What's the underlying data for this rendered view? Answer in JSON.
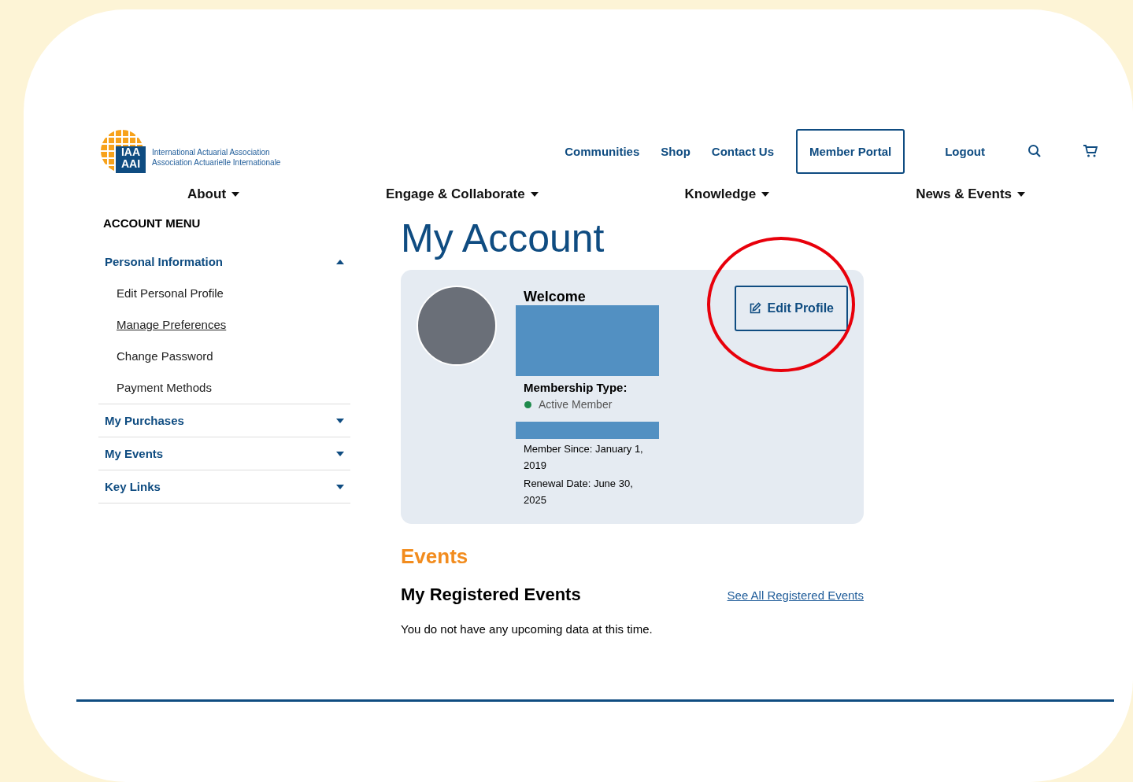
{
  "header": {
    "logo": {
      "mark_top": "IAA",
      "mark_bottom": "AAI",
      "line_1": "International Actuarial Association",
      "line_2": "Association Actuarielle Internationale"
    },
    "top_links": [
      {
        "label": "Communities",
        "kind": "link"
      },
      {
        "label": "Shop",
        "kind": "link"
      },
      {
        "label": "Contact Us",
        "kind": "link"
      },
      {
        "label": "Member Portal",
        "kind": "button"
      },
      {
        "label": "Logout",
        "kind": "link"
      }
    ]
  },
  "main_nav": [
    {
      "label": "About"
    },
    {
      "label": "Engage & Collaborate"
    },
    {
      "label": "Knowledge"
    },
    {
      "label": "News & Events"
    }
  ],
  "sidebar": {
    "title": "ACCOUNT MENU",
    "sections": [
      {
        "label": "Personal Information",
        "expanded": true,
        "children": [
          {
            "label": "Edit Personal Profile",
            "underlined": false
          },
          {
            "label": "Manage Preferences",
            "underlined": true
          },
          {
            "label": "Change Password",
            "underlined": false
          },
          {
            "label": "Payment Methods",
            "underlined": false
          }
        ]
      },
      {
        "label": "My Purchases",
        "expanded": false
      },
      {
        "label": "My Events",
        "expanded": false
      },
      {
        "label": "Key Links",
        "expanded": false
      }
    ]
  },
  "page_title": "My Account",
  "profile_card": {
    "welcome": "Welcome",
    "membership_label": "Membership Type:",
    "status": {
      "label": "Active Member",
      "color": "#1e8a4c"
    },
    "member_since": "Member Since: January 1, 2019",
    "renewal_date": "Renewal Date: June 30, 2025",
    "edit_button": {
      "label": "Edit Profile",
      "circled": true
    }
  },
  "events": {
    "heading": "Events",
    "subheading": "My Registered Events",
    "link": "See All Registered Events",
    "empty_message": "You do not have any upcoming data at this time."
  }
}
